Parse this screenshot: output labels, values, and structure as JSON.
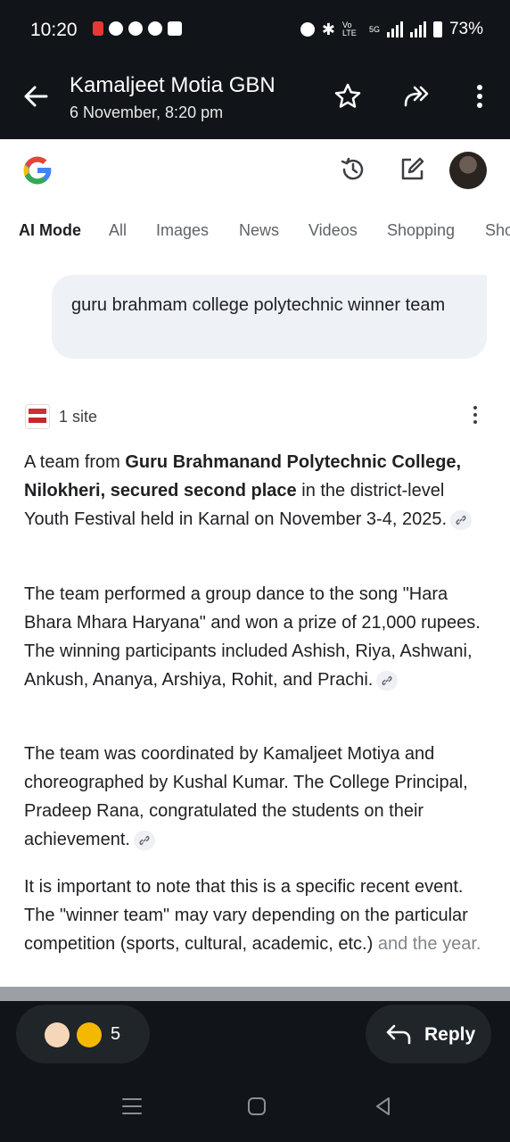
{
  "status_bar": {
    "time": "10:20",
    "network_label": "Vo LTE",
    "signal_label": "5G",
    "battery": "73%"
  },
  "header": {
    "title": "Kamaljeet Motia GBN",
    "subtitle": "6 November, 8:20 pm"
  },
  "tabs": [
    "AI Mode",
    "All",
    "Images",
    "News",
    "Videos",
    "Shopping",
    "Sho"
  ],
  "query": "guru brahmam college polytechnic winner team",
  "sources_label": "1 site",
  "answer": {
    "p1_pre": "A team from ",
    "p1_bold": "Guru Brahmanand Polytechnic College, Nilokheri, secured second place",
    "p1_post": " in the district-level Youth Festival held in Karnal on November 3-4, 2025.",
    "p2": "The team performed a group dance to the song \"Hara Bhara Mhara Haryana\" and won a prize of 21,000 rupees. The winning participants included Ashish, Riya, Ashwani, Ankush, Ananya, Arshiya, Rohit, and Prachi.",
    "p3": "The team was coordinated by Kamaljeet Motiya and choreographed by Kushal Kumar. The College Principal, Pradeep Rana, congratulated the students on their achievement.",
    "p4_main": "It is important to note that this is a specific recent event. The \"winner team\" may vary depending on the particular competition (sports, cultural, academic, etc.)",
    "p4_fade": "and the year."
  },
  "reactions": {
    "count": "5",
    "emoji_icons": [
      "clapping-hands-icon",
      "thumbs-up-icon"
    ]
  },
  "reply_label": "Reply",
  "colors": {
    "background_dark": "#111418",
    "content_bg": "#ffffff",
    "query_bubble": "#eef1f6",
    "google_blue": "#4285F4",
    "google_red": "#EA4335",
    "google_yellow": "#FBBC05",
    "google_green": "#34A853"
  }
}
